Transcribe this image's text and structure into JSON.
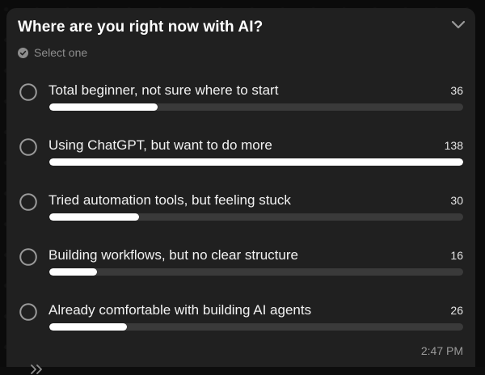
{
  "poll": {
    "title": "Where are you right now with AI?",
    "subtitle": "Select one",
    "timestamp": "2:47 PM",
    "options": [
      {
        "label": "Total beginner, not sure where to start",
        "votes": 36
      },
      {
        "label": "Using ChatGPT, but want to do more",
        "votes": 138
      },
      {
        "label": "Tried automation tools, but feeling stuck",
        "votes": 30
      },
      {
        "label": "Building workflows, but no clear structure",
        "votes": 16
      },
      {
        "label": "Already comfortable with building AI agents",
        "votes": 26
      }
    ]
  },
  "colors": {
    "card_background": "#202020",
    "bar_fill": "#ffffff",
    "bar_track": "#3a3a3a",
    "muted_text": "#8e8e8e"
  },
  "icons": {
    "collapse": "chevron-down-icon",
    "subtitle": "check-circle-icon",
    "option": "radio-circle-icon",
    "forward": "forward-icon"
  }
}
